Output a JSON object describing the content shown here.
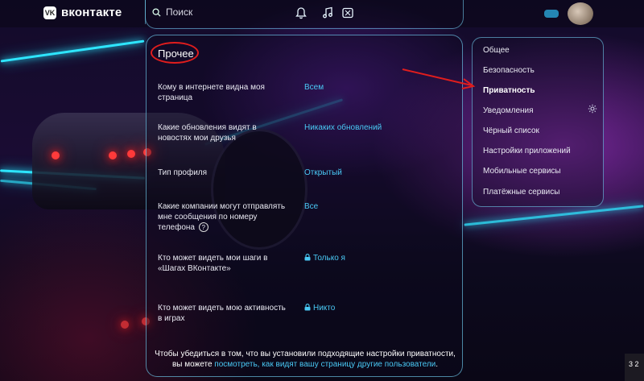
{
  "header": {
    "logo_text": "вконтакте",
    "logo_mark": "VK",
    "search_placeholder": "Поиск",
    "icons": [
      "search-icon",
      "bell-icon",
      "music-icon",
      "games-icon",
      "avatar"
    ]
  },
  "main": {
    "section_title": "Прочее",
    "rows": [
      {
        "label": "Кому в интернете видна моя страница",
        "value": "Всем",
        "locked": false
      },
      {
        "label": "Какие обновления видят в новостях мои друзья",
        "value": "Никаких обновлений",
        "locked": false
      },
      {
        "label": "Тип профиля",
        "value": "Открытый",
        "locked": false
      },
      {
        "label": "Какие компании могут отправлять мне сообщения по номеру телефона",
        "value": "Все",
        "locked": false,
        "help": "?"
      },
      {
        "label": "Кто может видеть мои шаги в «Шагах ВКонтакте»",
        "value": "Только я",
        "locked": true
      },
      {
        "label": "Кто может видеть мою активность в играх",
        "value": "Никто",
        "locked": true
      }
    ],
    "footer_text": "Чтобы убедиться в том, что вы установили подходящие настройки приватности, вы можете",
    "footer_link": "посмотреть, как видят вашу страницу другие пользователи",
    "footer_end": "."
  },
  "nav": {
    "items": [
      {
        "label": "Общее",
        "active": false
      },
      {
        "label": "Безопасность",
        "active": false
      },
      {
        "label": "Приватность",
        "active": true
      },
      {
        "label": "Уведомления",
        "active": false,
        "icon": "gear-icon"
      },
      {
        "label": "Чёрный список",
        "active": false
      },
      {
        "label": "Настройки приложений",
        "active": false
      },
      {
        "label": "Мобильные сервисы",
        "active": false
      },
      {
        "label": "Платёжные сервисы",
        "active": false
      }
    ]
  },
  "corner": {
    "text": "3 2"
  },
  "colors": {
    "accent": "#49c9f5",
    "border": "#78dcff",
    "annotation": "#e01d1d"
  }
}
